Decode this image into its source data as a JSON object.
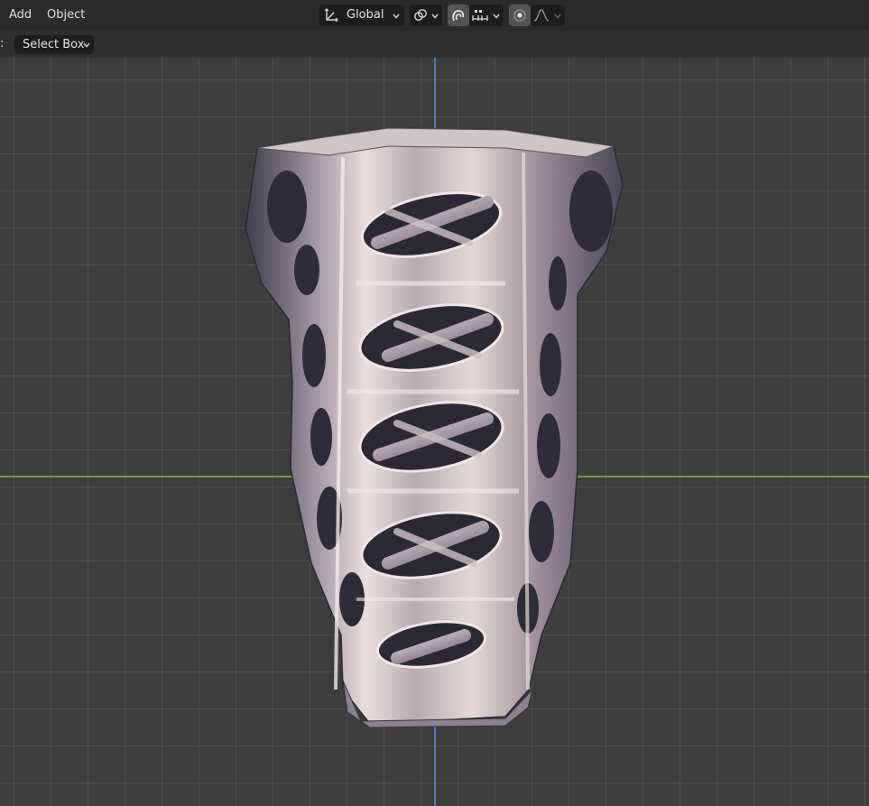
{
  "header": {
    "menu": [
      "Add",
      "Object"
    ],
    "transform_orientation": "Global"
  },
  "toolbar": {
    "prefix": ":",
    "select_mode": "Select Box"
  },
  "viewport": {
    "axis_colors": {
      "x_axis": "#6f9d3a",
      "z_axis": "#4a7fc1"
    },
    "object": "metallic lattice vase"
  },
  "icons": {
    "orientation": "transform-orientation-icon",
    "pivot": "link-pivot-icon",
    "snap": "snap-magnet-icon",
    "snap_increment": "snap-increment-icon",
    "proportional": "proportional-editing-icon",
    "falloff": "falloff-curve-icon"
  }
}
